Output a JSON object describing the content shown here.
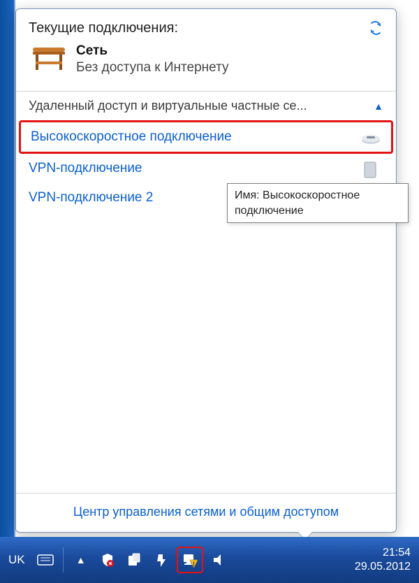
{
  "popup": {
    "title": "Текущие подключения:",
    "network": {
      "name": "Сеть",
      "status": "Без доступа к Интернету"
    },
    "section_header": "Удаленный доступ и виртуальные частные се...",
    "items": [
      {
        "label": "Высокоскоростное подключение",
        "highlight": true
      },
      {
        "label": "VPN-подключение"
      },
      {
        "label": "VPN-подключение 2"
      }
    ],
    "tooltip": "Имя: Высокоскоростное подключение",
    "bottom_link": "Центр управления сетями и общим доступом"
  },
  "taskbar": {
    "language": "UK",
    "time": "21:54",
    "date": "29.05.2012"
  }
}
